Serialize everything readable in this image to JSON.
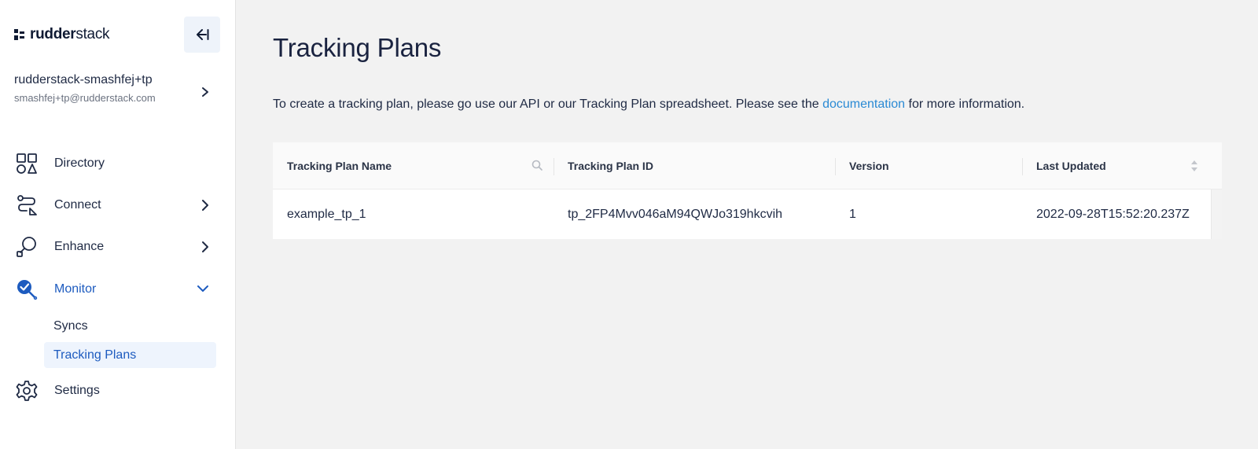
{
  "brand": {
    "name_bold": "rudder",
    "name_rest": "stack"
  },
  "workspace": {
    "name": "rudderstack-smashfej+tp",
    "email": "smashfej+tp@rudderstack.com"
  },
  "nav": {
    "directory": "Directory",
    "connect": "Connect",
    "enhance": "Enhance",
    "monitor": "Monitor",
    "monitor_children": {
      "syncs": "Syncs",
      "tracking_plans": "Tracking Plans"
    },
    "settings": "Settings"
  },
  "page": {
    "title": "Tracking Plans",
    "intro_before": "To create a tracking plan, please go use our API or our Tracking Plan spreadsheet. Please see the ",
    "intro_link": "documentation",
    "intro_after": " for more information."
  },
  "table": {
    "columns": [
      "Tracking Plan Name",
      "Tracking Plan ID",
      "Version",
      "Last Updated"
    ],
    "rows": [
      {
        "name": "example_tp_1",
        "id": "tp_2FP4Mvv046aM94QWJo319hkcvih",
        "version": "1",
        "updated": "2022-09-28T15:52:20.237Z"
      }
    ]
  },
  "icons": {
    "collapse": "collapse-sidebar-icon",
    "directory": "grid-shapes-icon",
    "connect": "route-connect-icon",
    "enhance": "transform-nodes-icon",
    "monitor": "magnifier-check-icon",
    "settings": "gear-icon",
    "search": "search-icon",
    "sort": "sort-icon"
  },
  "colors": {
    "accent": "#1d5bbf",
    "link": "#2a8ad4",
    "sidebar_bg": "#ffffff",
    "main_bg": "#f2f2f2",
    "selected_bg": "#eef4fd"
  }
}
